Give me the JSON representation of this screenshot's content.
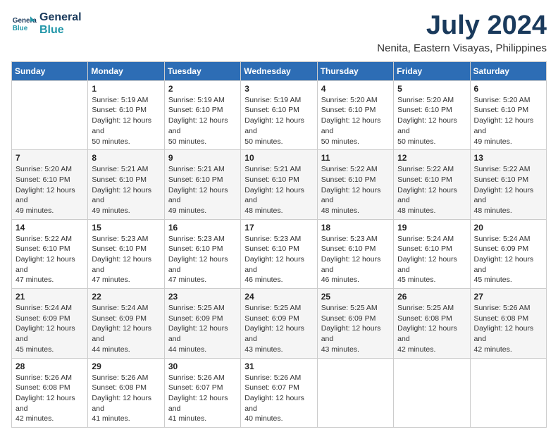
{
  "header": {
    "logo_line1": "General",
    "logo_line2": "Blue",
    "month_title": "July 2024",
    "location": "Nenita, Eastern Visayas, Philippines"
  },
  "weekdays": [
    "Sunday",
    "Monday",
    "Tuesday",
    "Wednesday",
    "Thursday",
    "Friday",
    "Saturday"
  ],
  "weeks": [
    [
      {
        "day": "",
        "sunrise": "",
        "sunset": "",
        "daylight": ""
      },
      {
        "day": "1",
        "sunrise": "Sunrise: 5:19 AM",
        "sunset": "Sunset: 6:10 PM",
        "daylight": "Daylight: 12 hours and 50 minutes."
      },
      {
        "day": "2",
        "sunrise": "Sunrise: 5:19 AM",
        "sunset": "Sunset: 6:10 PM",
        "daylight": "Daylight: 12 hours and 50 minutes."
      },
      {
        "day": "3",
        "sunrise": "Sunrise: 5:19 AM",
        "sunset": "Sunset: 6:10 PM",
        "daylight": "Daylight: 12 hours and 50 minutes."
      },
      {
        "day": "4",
        "sunrise": "Sunrise: 5:20 AM",
        "sunset": "Sunset: 6:10 PM",
        "daylight": "Daylight: 12 hours and 50 minutes."
      },
      {
        "day": "5",
        "sunrise": "Sunrise: 5:20 AM",
        "sunset": "Sunset: 6:10 PM",
        "daylight": "Daylight: 12 hours and 50 minutes."
      },
      {
        "day": "6",
        "sunrise": "Sunrise: 5:20 AM",
        "sunset": "Sunset: 6:10 PM",
        "daylight": "Daylight: 12 hours and 49 minutes."
      }
    ],
    [
      {
        "day": "7",
        "sunrise": "Sunrise: 5:20 AM",
        "sunset": "Sunset: 6:10 PM",
        "daylight": "Daylight: 12 hours and 49 minutes."
      },
      {
        "day": "8",
        "sunrise": "Sunrise: 5:21 AM",
        "sunset": "Sunset: 6:10 PM",
        "daylight": "Daylight: 12 hours and 49 minutes."
      },
      {
        "day": "9",
        "sunrise": "Sunrise: 5:21 AM",
        "sunset": "Sunset: 6:10 PM",
        "daylight": "Daylight: 12 hours and 49 minutes."
      },
      {
        "day": "10",
        "sunrise": "Sunrise: 5:21 AM",
        "sunset": "Sunset: 6:10 PM",
        "daylight": "Daylight: 12 hours and 48 minutes."
      },
      {
        "day": "11",
        "sunrise": "Sunrise: 5:22 AM",
        "sunset": "Sunset: 6:10 PM",
        "daylight": "Daylight: 12 hours and 48 minutes."
      },
      {
        "day": "12",
        "sunrise": "Sunrise: 5:22 AM",
        "sunset": "Sunset: 6:10 PM",
        "daylight": "Daylight: 12 hours and 48 minutes."
      },
      {
        "day": "13",
        "sunrise": "Sunrise: 5:22 AM",
        "sunset": "Sunset: 6:10 PM",
        "daylight": "Daylight: 12 hours and 48 minutes."
      }
    ],
    [
      {
        "day": "14",
        "sunrise": "Sunrise: 5:22 AM",
        "sunset": "Sunset: 6:10 PM",
        "daylight": "Daylight: 12 hours and 47 minutes."
      },
      {
        "day": "15",
        "sunrise": "Sunrise: 5:23 AM",
        "sunset": "Sunset: 6:10 PM",
        "daylight": "Daylight: 12 hours and 47 minutes."
      },
      {
        "day": "16",
        "sunrise": "Sunrise: 5:23 AM",
        "sunset": "Sunset: 6:10 PM",
        "daylight": "Daylight: 12 hours and 47 minutes."
      },
      {
        "day": "17",
        "sunrise": "Sunrise: 5:23 AM",
        "sunset": "Sunset: 6:10 PM",
        "daylight": "Daylight: 12 hours and 46 minutes."
      },
      {
        "day": "18",
        "sunrise": "Sunrise: 5:23 AM",
        "sunset": "Sunset: 6:10 PM",
        "daylight": "Daylight: 12 hours and 46 minutes."
      },
      {
        "day": "19",
        "sunrise": "Sunrise: 5:24 AM",
        "sunset": "Sunset: 6:10 PM",
        "daylight": "Daylight: 12 hours and 45 minutes."
      },
      {
        "day": "20",
        "sunrise": "Sunrise: 5:24 AM",
        "sunset": "Sunset: 6:09 PM",
        "daylight": "Daylight: 12 hours and 45 minutes."
      }
    ],
    [
      {
        "day": "21",
        "sunrise": "Sunrise: 5:24 AM",
        "sunset": "Sunset: 6:09 PM",
        "daylight": "Daylight: 12 hours and 45 minutes."
      },
      {
        "day": "22",
        "sunrise": "Sunrise: 5:24 AM",
        "sunset": "Sunset: 6:09 PM",
        "daylight": "Daylight: 12 hours and 44 minutes."
      },
      {
        "day": "23",
        "sunrise": "Sunrise: 5:25 AM",
        "sunset": "Sunset: 6:09 PM",
        "daylight": "Daylight: 12 hours and 44 minutes."
      },
      {
        "day": "24",
        "sunrise": "Sunrise: 5:25 AM",
        "sunset": "Sunset: 6:09 PM",
        "daylight": "Daylight: 12 hours and 43 minutes."
      },
      {
        "day": "25",
        "sunrise": "Sunrise: 5:25 AM",
        "sunset": "Sunset: 6:09 PM",
        "daylight": "Daylight: 12 hours and 43 minutes."
      },
      {
        "day": "26",
        "sunrise": "Sunrise: 5:25 AM",
        "sunset": "Sunset: 6:08 PM",
        "daylight": "Daylight: 12 hours and 42 minutes."
      },
      {
        "day": "27",
        "sunrise": "Sunrise: 5:26 AM",
        "sunset": "Sunset: 6:08 PM",
        "daylight": "Daylight: 12 hours and 42 minutes."
      }
    ],
    [
      {
        "day": "28",
        "sunrise": "Sunrise: 5:26 AM",
        "sunset": "Sunset: 6:08 PM",
        "daylight": "Daylight: 12 hours and 42 minutes."
      },
      {
        "day": "29",
        "sunrise": "Sunrise: 5:26 AM",
        "sunset": "Sunset: 6:08 PM",
        "daylight": "Daylight: 12 hours and 41 minutes."
      },
      {
        "day": "30",
        "sunrise": "Sunrise: 5:26 AM",
        "sunset": "Sunset: 6:07 PM",
        "daylight": "Daylight: 12 hours and 41 minutes."
      },
      {
        "day": "31",
        "sunrise": "Sunrise: 5:26 AM",
        "sunset": "Sunset: 6:07 PM",
        "daylight": "Daylight: 12 hours and 40 minutes."
      },
      {
        "day": "",
        "sunrise": "",
        "sunset": "",
        "daylight": ""
      },
      {
        "day": "",
        "sunrise": "",
        "sunset": "",
        "daylight": ""
      },
      {
        "day": "",
        "sunrise": "",
        "sunset": "",
        "daylight": ""
      }
    ]
  ]
}
